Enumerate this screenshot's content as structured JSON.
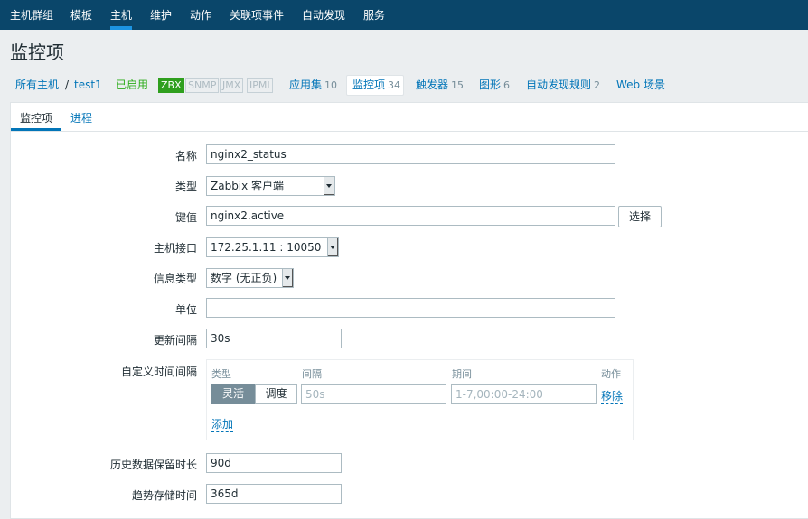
{
  "topnav": {
    "items": [
      {
        "label": "主机群组"
      },
      {
        "label": "模板"
      },
      {
        "label": "主机",
        "active": true
      },
      {
        "label": "维护"
      },
      {
        "label": "动作"
      },
      {
        "label": "关联项事件"
      },
      {
        "label": "自动发现"
      },
      {
        "label": "服务"
      }
    ]
  },
  "page": {
    "title": "监控项"
  },
  "breadcrumb": {
    "all_hosts": "所有主机",
    "separator": "/",
    "host": "test1",
    "status": "已启用"
  },
  "availability": {
    "zbx": "ZBX",
    "snmp": "SNMP",
    "jmx": "JMX",
    "ipmi": "IPMI"
  },
  "host_tabs": {
    "applications": {
      "label": "应用集",
      "count": "10"
    },
    "items": {
      "label": "监控项",
      "count": "34"
    },
    "triggers": {
      "label": "触发器",
      "count": "15"
    },
    "graphs": {
      "label": "图形",
      "count": "6"
    },
    "discovery": {
      "label": "自动发现规则",
      "count": "2"
    },
    "web": {
      "label": "Web 场景"
    }
  },
  "form_tabs": {
    "item": "监控项",
    "preprocessing": "进程"
  },
  "form": {
    "name": {
      "label": "名称",
      "value": "nginx2_status"
    },
    "type": {
      "label": "类型",
      "value": "Zabbix 客户端"
    },
    "key": {
      "label": "键值",
      "value": "nginx2.active",
      "select_button": "选择"
    },
    "interface": {
      "label": "主机接口",
      "value": "172.25.1.11 : 10050"
    },
    "info_type": {
      "label": "信息类型",
      "value": "数字 (无正负)"
    },
    "units": {
      "label": "单位",
      "value": ""
    },
    "update_interval": {
      "label": "更新间隔",
      "value": "30s"
    },
    "custom_intervals": {
      "label": "自定义时间间隔",
      "headers": {
        "type": "类型",
        "interval": "间隔",
        "period": "期间",
        "action": "动作"
      },
      "flexible": "灵活",
      "scheduling": "调度",
      "interval_placeholder": "50s",
      "period_placeholder": "1-7,00:00-24:00",
      "remove": "移除",
      "add": "添加"
    },
    "history": {
      "label": "历史数据保留时长",
      "value": "90d"
    },
    "trends": {
      "label": "趋势存储时间",
      "value": "365d"
    }
  },
  "colors": {
    "nav_bg": "#0a466a",
    "link": "#0275b8",
    "enabled": "#2dad1a",
    "zbx_badge": "#2f9f1e"
  }
}
